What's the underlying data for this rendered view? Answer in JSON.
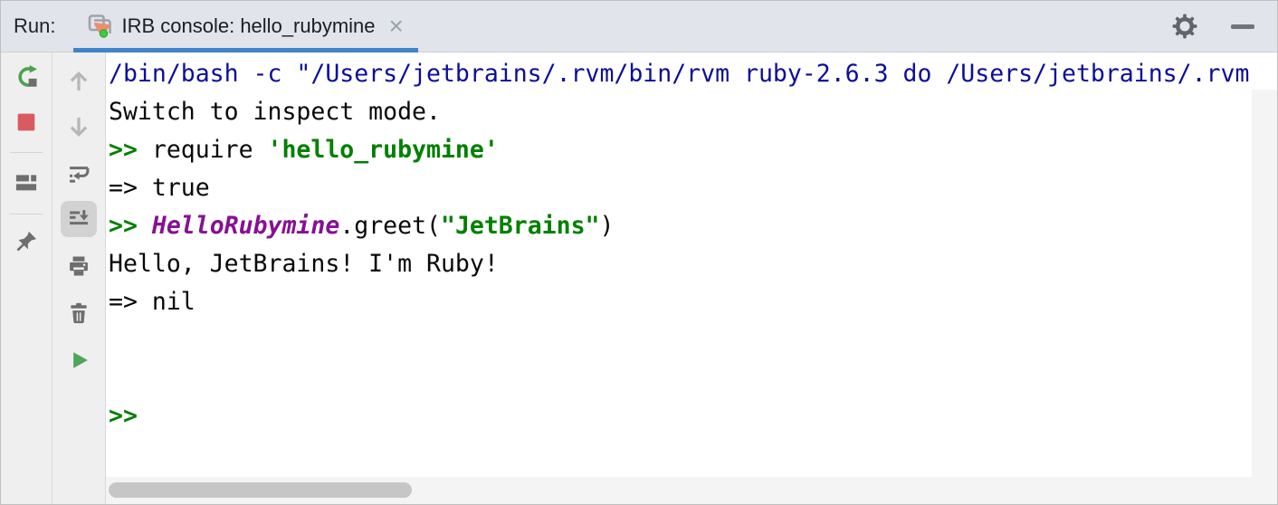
{
  "header": {
    "run_label": "Run:",
    "tab": {
      "label": "IRB console: hello_rubymine",
      "icon": "run-console-icon",
      "close_glyph": "×",
      "active": true
    },
    "actions": [
      {
        "name": "settings",
        "icon": "gear-icon"
      },
      {
        "name": "hide-window",
        "icon": "minimize-icon"
      }
    ]
  },
  "toolbar_main": {
    "items": [
      {
        "name": "rerun",
        "icon": "rerun-icon"
      },
      {
        "name": "stop",
        "icon": "stop-icon"
      },
      {
        "type": "divider"
      },
      {
        "name": "restore-layout",
        "icon": "layout-icon"
      },
      {
        "type": "divider"
      },
      {
        "name": "pin-tab",
        "icon": "pin-icon"
      }
    ]
  },
  "toolbar_console": {
    "items": [
      {
        "name": "up-the-stack-trace",
        "icon": "arrow-up-icon",
        "disabled": true
      },
      {
        "name": "down-the-stack-trace",
        "icon": "arrow-down-icon",
        "disabled": true
      },
      {
        "name": "use-soft-wraps",
        "icon": "soft-wrap-icon"
      },
      {
        "name": "scroll-to-end",
        "icon": "scroll-to-end-icon",
        "selected": true
      },
      {
        "name": "print",
        "icon": "printer-icon"
      },
      {
        "name": "clear-all",
        "icon": "trash-icon"
      },
      {
        "name": "execute-statement",
        "icon": "play-icon"
      }
    ]
  },
  "console": {
    "lines": [
      {
        "segments": [
          {
            "t": "/bin/bash -c \"/Users/jetbrains/.rvm/bin/rvm ruby-2.6.3 do /Users/jetbrains/.rvm",
            "c": "sys"
          }
        ]
      },
      {
        "segments": [
          {
            "t": "Switch to inspect mode.",
            "c": "plain"
          }
        ]
      },
      {
        "segments": [
          {
            "t": ">> ",
            "c": "prompt"
          },
          {
            "t": "require ",
            "c": "plain"
          },
          {
            "t": "'hello_rubymine'",
            "c": "string"
          }
        ]
      },
      {
        "segments": [
          {
            "t": "=> true",
            "c": "plain"
          }
        ]
      },
      {
        "segments": [
          {
            "t": ">> ",
            "c": "prompt"
          },
          {
            "t": "HelloRubymine",
            "c": "const"
          },
          {
            "t": ".greet(",
            "c": "plain"
          },
          {
            "t": "\"JetBrains\"",
            "c": "string"
          },
          {
            "t": ")",
            "c": "plain"
          }
        ]
      },
      {
        "segments": [
          {
            "t": "Hello, JetBrains! I'm Ruby!",
            "c": "plain"
          }
        ]
      },
      {
        "segments": [
          {
            "t": "=> nil",
            "c": "plain"
          }
        ]
      },
      {
        "segments": []
      },
      {
        "segments": []
      },
      {
        "segments": [
          {
            "t": ">>",
            "c": "prompt"
          }
        ]
      }
    ]
  },
  "colors": {
    "header_bg": "#E2E4EC",
    "accent_tab_underline": "#4083C9",
    "console_system_text": "#0D0D99",
    "console_text": "#080808",
    "console_prompt_green": "#008000",
    "console_string_green": "#008000",
    "console_constant_purple": "#871094",
    "run_green": "#4BA24E",
    "stop_red": "#D85B5E",
    "play_green": "#4FA55A",
    "icon_gray": "#6E6E6E",
    "icon_disabled_gray": "#B7B7B7"
  }
}
